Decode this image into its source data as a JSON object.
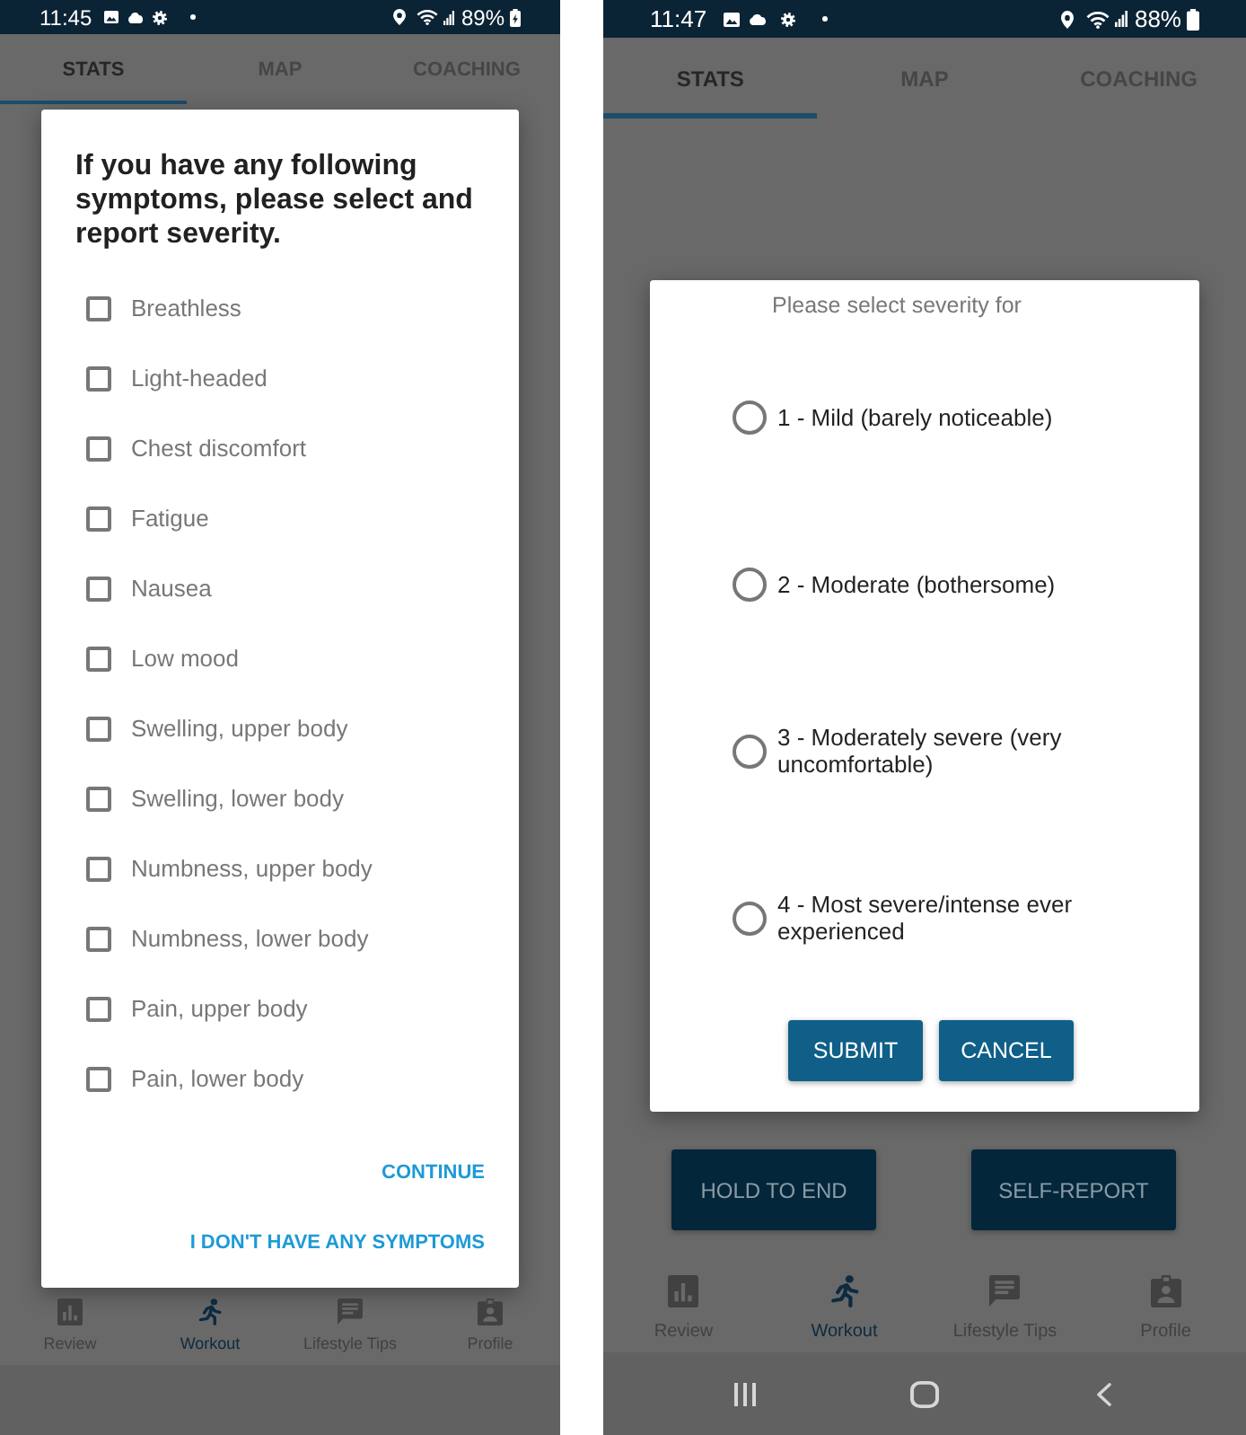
{
  "screens": [
    {
      "status_bar": {
        "time": "11:45",
        "battery": "89%",
        "charging": true
      },
      "tabs": [
        {
          "label": "STATS",
          "selected": true
        },
        {
          "label": "MAP",
          "selected": false
        },
        {
          "label": "COACHING",
          "selected": false
        }
      ],
      "dialog": {
        "kind": "checklist",
        "title": "If you have any following symptoms, please select and report severity.",
        "options": [
          {
            "label": "Breathless",
            "checked": false
          },
          {
            "label": "Light-headed",
            "checked": false
          },
          {
            "label": "Chest discomfort",
            "checked": false
          },
          {
            "label": "Fatigue",
            "checked": false
          },
          {
            "label": "Nausea",
            "checked": false
          },
          {
            "label": "Low mood",
            "checked": false
          },
          {
            "label": "Swelling, upper body",
            "checked": false
          },
          {
            "label": "Swelling, lower body",
            "checked": false
          },
          {
            "label": "Numbness, upper body",
            "checked": false
          },
          {
            "label": "Numbness, lower body",
            "checked": false
          },
          {
            "label": "Pain, upper body",
            "checked": false
          },
          {
            "label": "Pain, lower body",
            "checked": false
          }
        ],
        "actions": [
          "CONTINUE",
          "I DON'T HAVE ANY SYMPTOMS"
        ]
      },
      "bottom_nav": [
        {
          "label": "Review",
          "selected": false
        },
        {
          "label": "Workout",
          "selected": true
        },
        {
          "label": "Lifestyle Tips",
          "selected": false
        },
        {
          "label": "Profile",
          "selected": false
        }
      ],
      "system_nav_buttons": false
    },
    {
      "status_bar": {
        "time": "11:47",
        "battery": "88%",
        "charging": false
      },
      "tabs": [
        {
          "label": "STATS",
          "selected": true
        },
        {
          "label": "MAP",
          "selected": false
        },
        {
          "label": "COACHING",
          "selected": false
        }
      ],
      "dialog": {
        "kind": "radio",
        "prompt": "Please select severity for",
        "options": [
          {
            "label": "1 - Mild (barely noticeable)",
            "selected": false
          },
          {
            "label": "2 - Moderate (bothersome)",
            "selected": false
          },
          {
            "label": "3 - Moderately severe (very uncomfortable)",
            "selected": false
          },
          {
            "label": "4 - Most severe/intense ever experienced",
            "selected": false
          }
        ],
        "actions": [
          "SUBMIT",
          "CANCEL"
        ]
      },
      "screen_buttons": [
        "HOLD TO END",
        "SELF-REPORT"
      ],
      "bottom_nav": [
        {
          "label": "Review",
          "selected": false
        },
        {
          "label": "Workout",
          "selected": true
        },
        {
          "label": "Lifestyle Tips",
          "selected": false
        },
        {
          "label": "Profile",
          "selected": false
        }
      ],
      "system_nav_buttons": true
    }
  ]
}
